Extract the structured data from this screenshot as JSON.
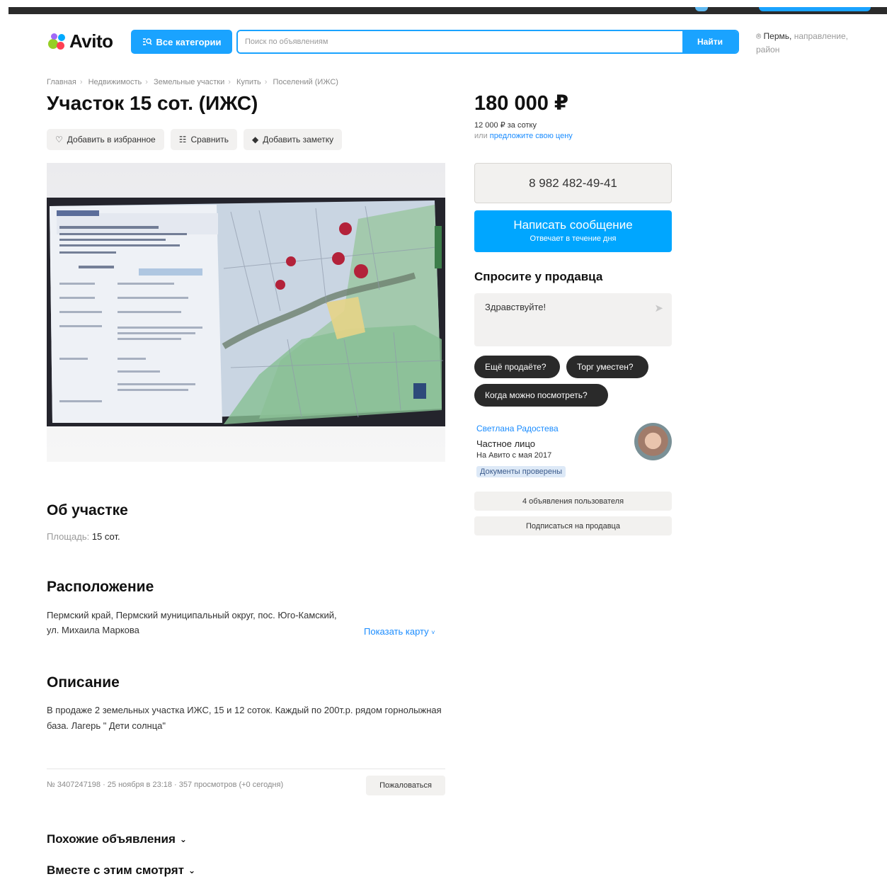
{
  "header": {
    "logo": "Avito",
    "categories_button": "Все категории",
    "search_placeholder": "Поиск по объявлениям",
    "search_button": "Найти",
    "location_city": "Пермь,",
    "location_hint": "направление, район"
  },
  "breadcrumbs": [
    "Главная",
    "Недвижимость",
    "Земельные участки",
    "Купить",
    "Поселений (ИЖС)"
  ],
  "listing": {
    "title": "Участок 15 сот. (ИЖС)",
    "actions": {
      "favorite": "Добавить в избранное",
      "compare": "Сравнить",
      "note": "Добавить заметку"
    }
  },
  "pricing": {
    "price": "180 000 ₽",
    "per_unit": "12 000 ₽ за сотку",
    "offer_prefix": "или",
    "offer_link": "предложите свою цену"
  },
  "contact": {
    "phone": "8 982 482-49-41",
    "message_button": "Написать сообщение",
    "message_sub": "Отвечает в течение дня"
  },
  "ask": {
    "heading": "Спросите у продавца",
    "input_value": "Здравствуйте!",
    "chips": [
      "Ещё продаёте?",
      "Торг уместен?",
      "Когда можно посмотреть?"
    ]
  },
  "seller": {
    "name": "Светлана Радостева",
    "type": "Частное лицо",
    "since": "На Авито с мая 2017",
    "docs_badge": "Документы проверены",
    "listings_button": "4 объявления пользователя",
    "subscribe_button": "Подписаться на продавца"
  },
  "about": {
    "heading": "Об участке",
    "area_label": "Площадь:",
    "area_value": "15 сот."
  },
  "location": {
    "heading": "Расположение",
    "address": "Пермский край, Пермский муниципальный округ, пос. Юго-Камский, ул. Михаила Маркова",
    "show_map": "Показать карту"
  },
  "description": {
    "heading": "Описание",
    "text": "В продаже 2 земельных участка ИЖС, 15 и 12 соток. Каждый по 200т.р. рядом горнолыжная база. Лагерь \" Дети солнца\""
  },
  "meta": {
    "info": "№ 3407247198 · 25 ноября в 23:18 · 357 просмотров (+0 сегодня)",
    "complain_button": "Пожаловаться"
  },
  "footer_sections": [
    "Похожие объявления",
    "Вместе с этим смотрят"
  ],
  "colors": {
    "accent": "#1aa3ff",
    "message_button": "#00a6ff",
    "link": "#1a8cff",
    "chip": "#2a2a2a"
  }
}
